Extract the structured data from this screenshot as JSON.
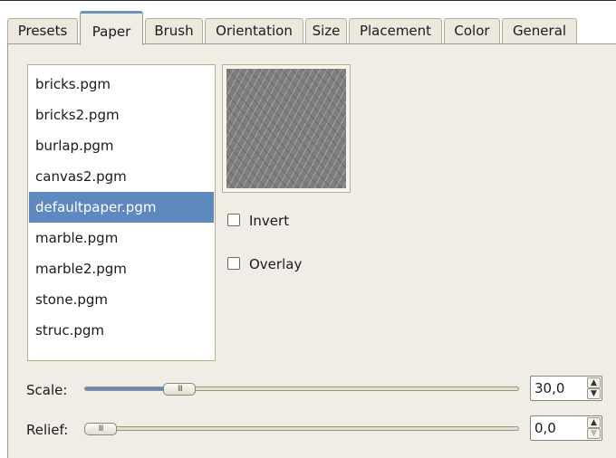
{
  "tabs": [
    {
      "id": "presets",
      "label": "Presets"
    },
    {
      "id": "paper",
      "label": "Paper"
    },
    {
      "id": "brush",
      "label": "Brush"
    },
    {
      "id": "orientation",
      "label": "Orientation"
    },
    {
      "id": "size",
      "label": "Size"
    },
    {
      "id": "placement",
      "label": "Placement"
    },
    {
      "id": "color",
      "label": "Color"
    },
    {
      "id": "general",
      "label": "General"
    }
  ],
  "active_tab": "Paper",
  "papers": [
    "bricks.pgm",
    "bricks2.pgm",
    "burlap.pgm",
    "canvas2.pgm",
    "defaultpaper.pgm",
    "marble.pgm",
    "marble2.pgm",
    "stone.pgm",
    "struc.pgm"
  ],
  "selected_paper": "defaultpaper.pgm",
  "options": {
    "invert": {
      "label": "Invert",
      "checked": false
    },
    "overlay": {
      "label": "Overlay",
      "checked": false
    }
  },
  "scale": {
    "label": "Scale:",
    "value": "30,0",
    "fraction": 0.197
  },
  "relief": {
    "label": "Relief:",
    "value": "0,0",
    "fraction": 0.0
  },
  "colors": {
    "accent": "#5e89bf",
    "background": "#f0ede6"
  }
}
